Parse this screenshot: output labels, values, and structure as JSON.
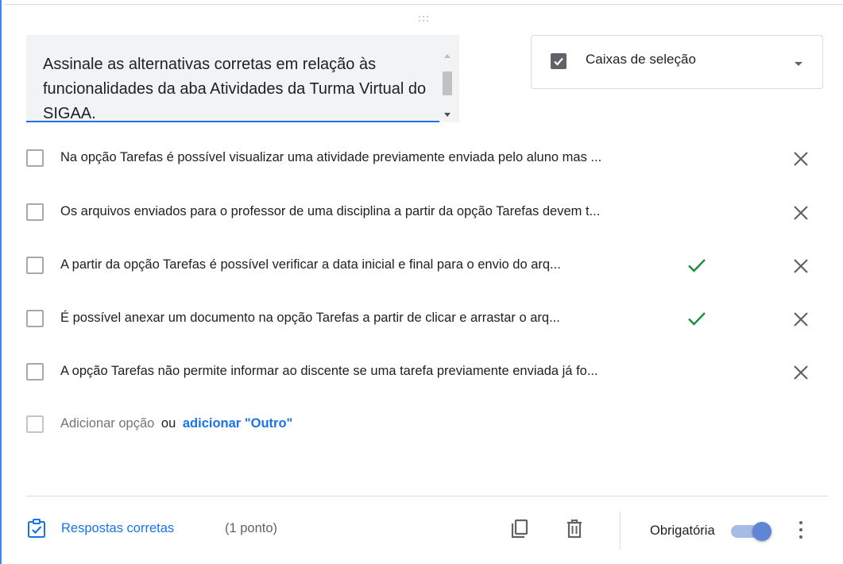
{
  "question": {
    "text": "Assinale as alternativas corretas em relação às funcionalidades da aba Atividades da Turma Virtual do SIGAA."
  },
  "question_type": {
    "selected": "Caixas de seleção",
    "icon": "checkbox-icon"
  },
  "options": [
    {
      "label": "Na opção Tarefas é possível visualizar uma atividade previamente enviada pelo aluno mas ...",
      "correct": false
    },
    {
      "label": "Os arquivos enviados para o professor de uma disciplina a partir da opção Tarefas devem t...",
      "correct": false
    },
    {
      "label": "A partir da opção Tarefas é possível verificar a data inicial e final para o envio do arq...",
      "correct": true
    },
    {
      "label": "É possível anexar um documento na opção Tarefas a partir de clicar e arrastar o arq...",
      "correct": true
    },
    {
      "label": "A opção Tarefas não permite informar ao discente se uma tarefa previamente enviada já fo...",
      "correct": false
    }
  ],
  "add_option": {
    "add_label": "Adicionar opção",
    "or_label": "ou",
    "add_other_label": "adicionar \"Outro\""
  },
  "footer": {
    "answer_key_label": "Respostas corretas",
    "points_label": "(1 ponto)",
    "required_label": "Obrigatória",
    "required_on": true
  },
  "colors": {
    "accent": "#1a73e8",
    "correct_check": "#1e8e3e",
    "icon_gray": "#5f6368"
  }
}
